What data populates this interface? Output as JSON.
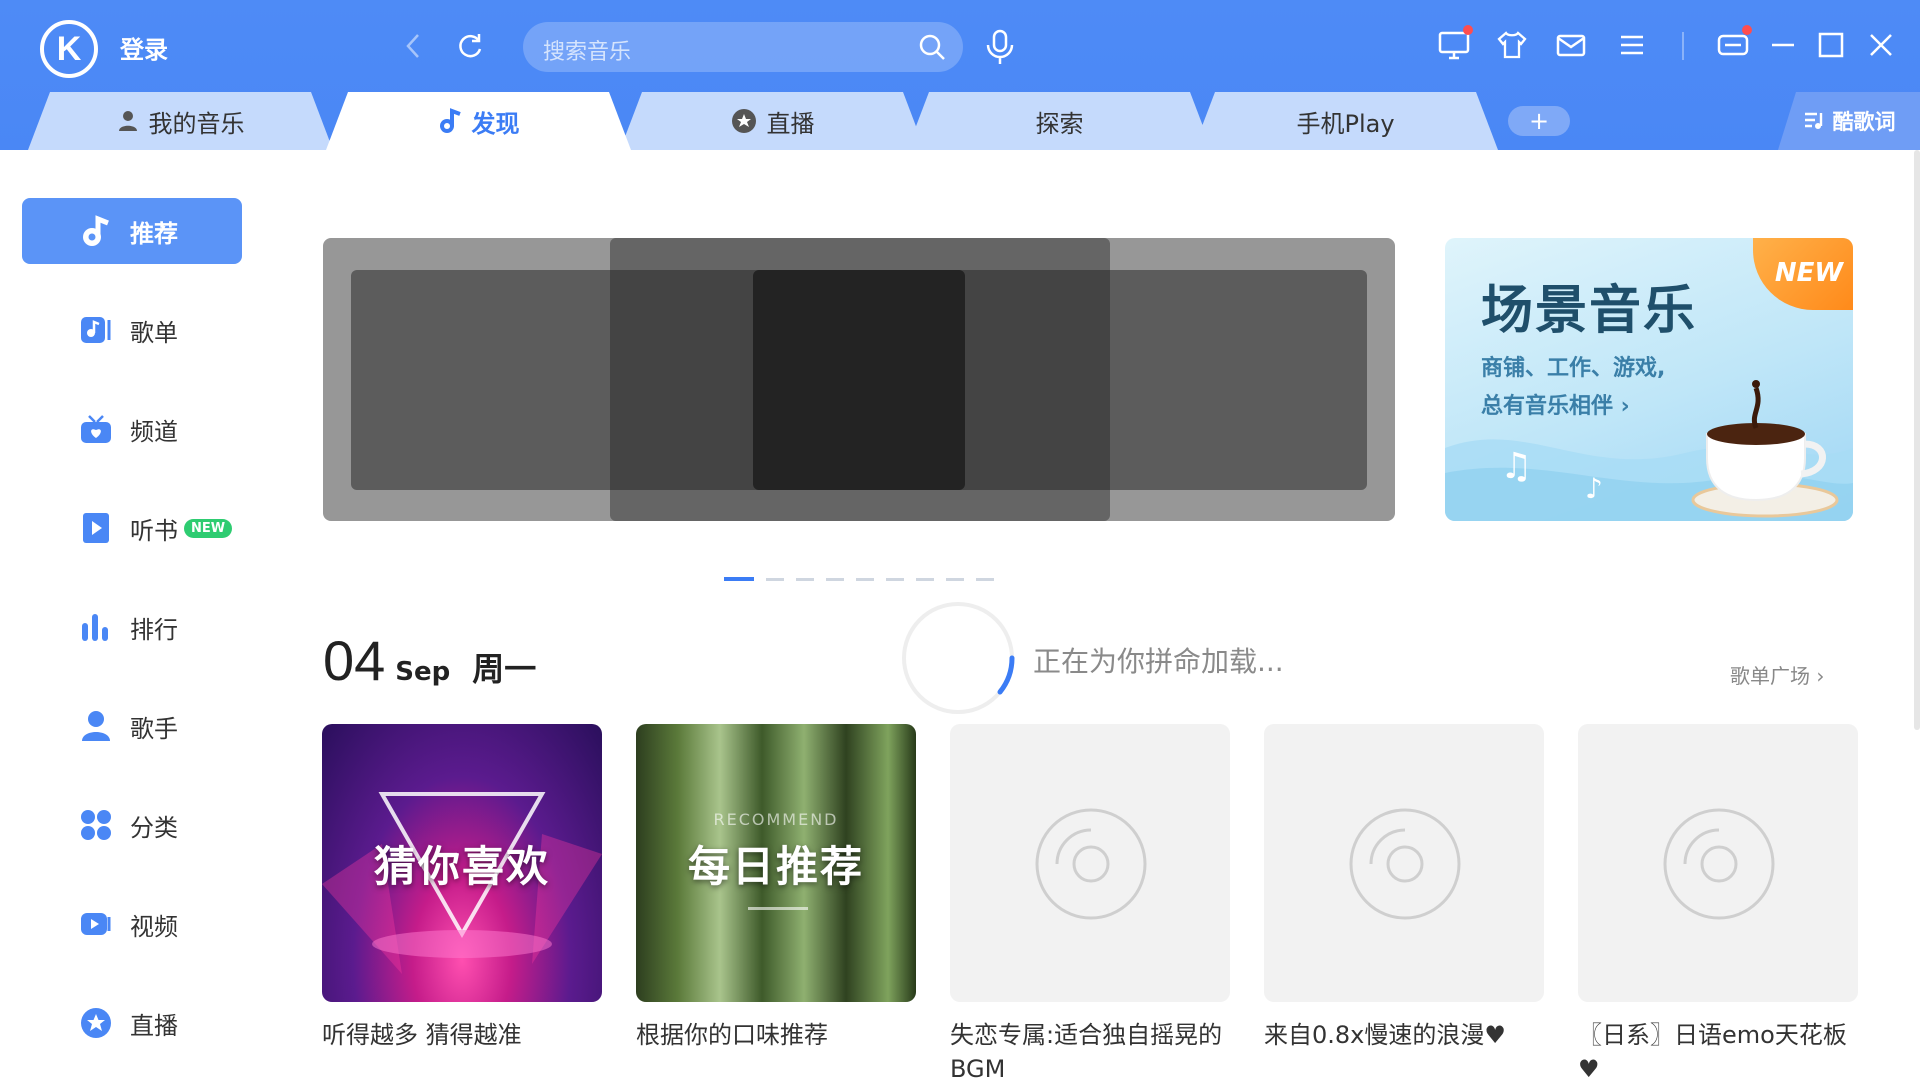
{
  "header": {
    "logo": "K",
    "login": "登录",
    "search_placeholder": "搜索音乐"
  },
  "tabs": [
    {
      "label": "我的音乐",
      "icon": "user-icon"
    },
    {
      "label": "发现",
      "icon": "music-note-icon",
      "active": true
    },
    {
      "label": "直播",
      "icon": "live-icon"
    },
    {
      "label": "探索"
    },
    {
      "label": "手机Play"
    }
  ],
  "tab_add": "+",
  "lyrics_label": "酷歌词",
  "sidebar": [
    {
      "label": "推荐",
      "icon": "music-note-icon",
      "active": true
    },
    {
      "label": "歌单",
      "icon": "playlist-icon"
    },
    {
      "label": "频道",
      "icon": "radio-icon"
    },
    {
      "label": "听书",
      "icon": "book-icon",
      "badge": "NEW"
    },
    {
      "label": "排行",
      "icon": "chart-icon"
    },
    {
      "label": "歌手",
      "icon": "singer-icon"
    },
    {
      "label": "分类",
      "icon": "category-icon"
    },
    {
      "label": "视频",
      "icon": "video-icon"
    },
    {
      "label": "直播",
      "icon": "live-icon"
    }
  ],
  "scene": {
    "title": "场景音乐",
    "line1": "商铺、工作、游戏,",
    "line2": "总有音乐相伴 ›",
    "badge": "NEW"
  },
  "banner_dots": {
    "count": 9,
    "active": 0
  },
  "date": {
    "day": "04",
    "month": "Sep",
    "weekday": "周一"
  },
  "loading_text": "正在为你拼命加载...",
  "more_link": "歌单广场 ›",
  "cards": [
    {
      "cover_text": "猜你喜欢",
      "title": "听得越多 猜得越准"
    },
    {
      "cover_text": "每日推荐",
      "cover_sub": "RECOMMEND",
      "title": "根据你的口味推荐"
    },
    {
      "title": "失恋专属:适合独自摇晃的BGM"
    },
    {
      "title": "来自0.8x慢速的浪漫♥"
    },
    {
      "title": "〖日系〗日语emo天花板♥"
    }
  ],
  "colors": {
    "brand": "#4e8bf6",
    "active_tab_text": "#3b7cf5",
    "sidebar_active": "#5b94f7"
  }
}
